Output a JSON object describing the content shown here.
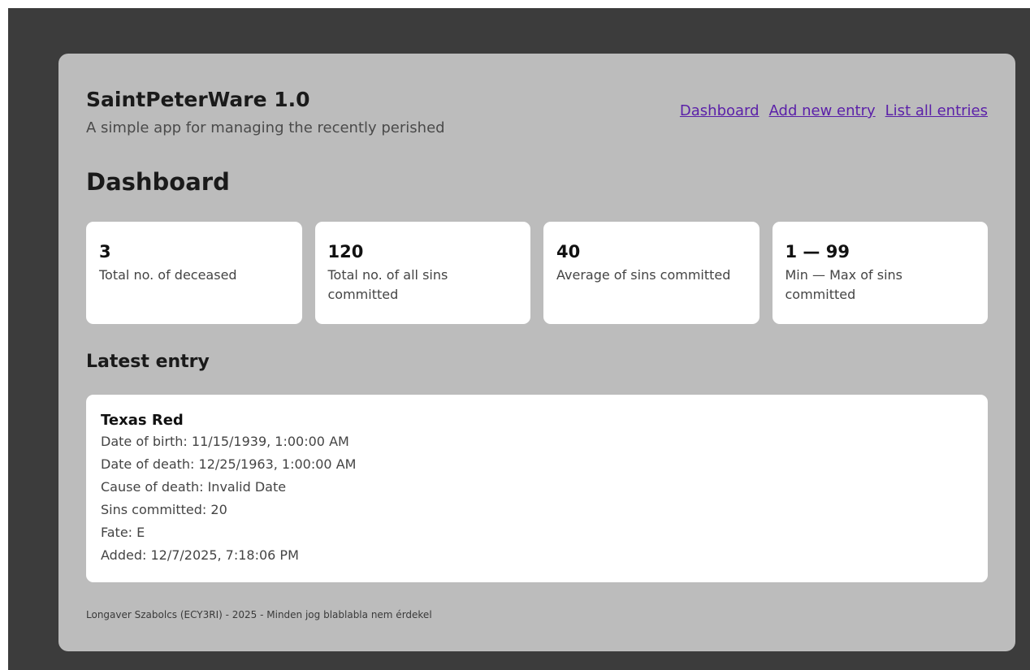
{
  "app": {
    "title": "SaintPeterWare 1.0",
    "subtitle": "A simple app for managing the recently perished"
  },
  "nav": {
    "items": [
      {
        "label": "Dashboard"
      },
      {
        "label": "Add new entry"
      },
      {
        "label": "List all entries"
      }
    ]
  },
  "page": {
    "title": "Dashboard"
  },
  "stats": [
    {
      "value": "3",
      "label": "Total no. of deceased"
    },
    {
      "value": "120",
      "label": "Total no. of all sins committed"
    },
    {
      "value": "40",
      "label": "Average of sins committed"
    },
    {
      "value": "1 — 99",
      "label": "Min — Max of sins committed"
    }
  ],
  "latest": {
    "heading": "Latest entry",
    "name": "Texas Red",
    "lines": [
      "Date of birth: 11/15/1939, 1:00:00 AM",
      "Date of death: 12/25/1963, 1:00:00 AM",
      "Cause of death: Invalid Date",
      "Sins committed: 20",
      "Fate: E",
      "Added: 12/7/2025, 7:18:06 PM"
    ]
  },
  "footer": {
    "text": "Longaver Szabolcs (ECY3RI) - 2025 - Minden jog blablabla nem érdekel"
  },
  "colors": {
    "backdrop": "#3c3c3c",
    "panel": "#bcbcbc",
    "card": "#ffffff",
    "link": "#5a1fa8"
  }
}
